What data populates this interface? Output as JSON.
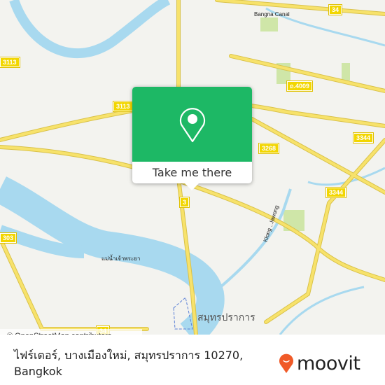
{
  "map": {
    "road_shields": [
      "34",
      "3113",
      "3113",
      "ถ.4009",
      "3268",
      "3344",
      "3344",
      "3",
      "303",
      "34"
    ],
    "labels": {
      "bangna_canal": "Bangna Canal",
      "chao_phraya": "แม่น้ำเจ้าพระยา",
      "klong": "Klong ...lawong",
      "samut_prakan": "สมุทรปราการ"
    },
    "attribution": "© OpenStreetMap contributors",
    "colors": {
      "water": "#a8d9ef",
      "road": "#f7e26b",
      "land": "#f3f3ef",
      "park": "#cfe6a8"
    }
  },
  "popup": {
    "icon": "map-pin-icon",
    "button_label": "Take me there",
    "color": "#1db865"
  },
  "footer": {
    "address_line1": "ไฟร์เตอร์, บางเมืองใหม่, สมุทรปราการ 10270,",
    "address_line2": "Bangkok",
    "brand": "moovit",
    "brand_color": "#f05a28"
  }
}
